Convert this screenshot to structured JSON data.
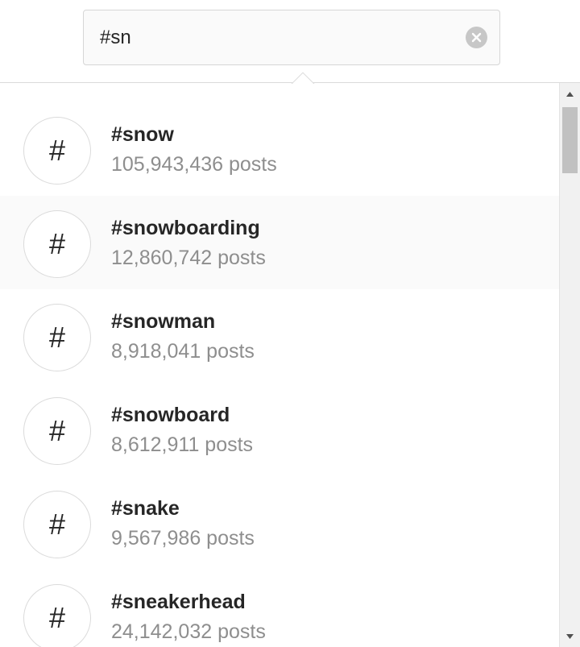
{
  "search": {
    "value": "#sn",
    "clear_icon": "clear-circle-icon"
  },
  "results": {
    "items": [
      {
        "icon": "#",
        "tag": "#snow",
        "count": "105,943,436 posts"
      },
      {
        "icon": "#",
        "tag": "#snowboarding",
        "count": "12,860,742 posts"
      },
      {
        "icon": "#",
        "tag": "#snowman",
        "count": "8,918,041 posts"
      },
      {
        "icon": "#",
        "tag": "#snowboard",
        "count": "8,612,911 posts"
      },
      {
        "icon": "#",
        "tag": "#snake",
        "count": "9,567,986 posts"
      },
      {
        "icon": "#",
        "tag": "#sneakerhead",
        "count": "24,142,032 posts"
      }
    ]
  },
  "colors": {
    "text_primary": "#262626",
    "text_secondary": "#8e8e8e",
    "highlight_row": "#fafafa",
    "border": "#dbdbdb"
  }
}
